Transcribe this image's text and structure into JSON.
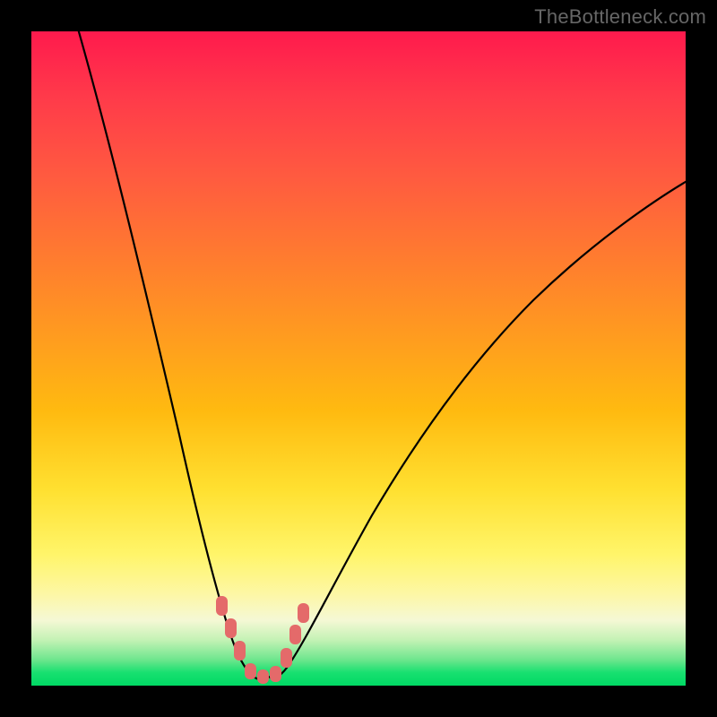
{
  "watermark": "TheBottleneck.com",
  "colors": {
    "frame": "#000000",
    "marker": "#e46a6a",
    "curve": "#000000"
  },
  "chart_data": {
    "type": "line",
    "title": "",
    "xlabel": "",
    "ylabel": "",
    "xlim": [
      0,
      100
    ],
    "ylim": [
      0,
      100
    ],
    "grid": false,
    "note": "V-shaped bottleneck curve on red→green vertical gradient. Axis tick values are not rendered in the image, so x/y values below are chart-relative positions (0–100 each).",
    "series": [
      {
        "name": "bottleneck-curve",
        "x": [
          7,
          10,
          13,
          16,
          19,
          22,
          25,
          27,
          29,
          31,
          33,
          35,
          38,
          42,
          47,
          54,
          62,
          72,
          84,
          100
        ],
        "y": [
          100,
          88,
          76,
          64,
          52,
          40,
          28,
          18,
          10,
          4,
          1,
          0.5,
          2,
          8,
          18,
          32,
          48,
          62,
          74,
          82
        ]
      }
    ],
    "markers": {
      "name": "highlighted-range",
      "x": [
        27.5,
        29.2,
        31.0,
        33.0,
        35.0,
        36.8,
        38.0,
        39.0
      ],
      "y": [
        15.5,
        9.0,
        4.0,
        1.2,
        0.7,
        2.8,
        7.5,
        12.0
      ]
    }
  }
}
